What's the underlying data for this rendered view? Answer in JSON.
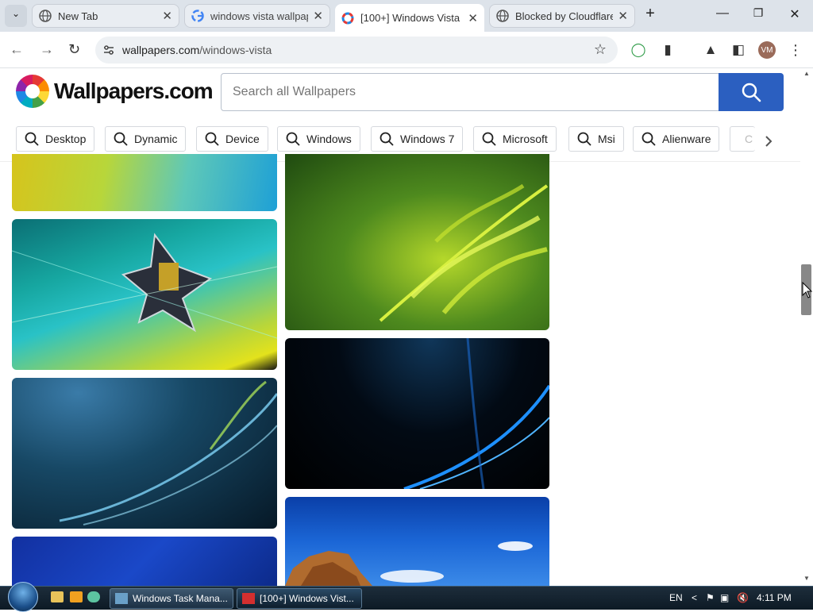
{
  "browser": {
    "tabs": [
      {
        "title": "New Tab",
        "favicon": "globe-icon",
        "active": false
      },
      {
        "title": "windows vista wallpaper",
        "favicon": "google-icon",
        "active": false
      },
      {
        "title": "[100+] Windows Vista",
        "favicon": "wallpapers-icon",
        "active": true
      },
      {
        "title": "Blocked by Cloudflare",
        "favicon": "globe-icon",
        "active": false
      }
    ],
    "url_host": "wallpapers.com",
    "url_path": "/windows-vista",
    "profile_initials": "VM"
  },
  "site": {
    "logo_text": "Wallpapers.com",
    "search_placeholder": "Search all Wallpapers",
    "chips": [
      "Desktop",
      "Dynamic",
      "Device",
      "Windows",
      "Windows 7",
      "Microsoft",
      "Msi",
      "Alienware",
      "C"
    ],
    "accent": "#2b5fc0",
    "wallpapers": [
      {
        "name": "wallpaper-yellow-teal"
      },
      {
        "name": "wallpaper-shattered-motherboard"
      },
      {
        "name": "wallpaper-blue-aurora"
      },
      {
        "name": "wallpaper-blue-partial"
      },
      {
        "name": "wallpaper-green-fern"
      },
      {
        "name": "wallpaper-black-blue-streak"
      },
      {
        "name": "wallpaper-sky-rocks"
      }
    ]
  },
  "taskbar": {
    "items": [
      {
        "label": "Windows Task Mana..."
      },
      {
        "label": "[100+] Windows Vist..."
      }
    ],
    "language": "EN",
    "time": "4:11 PM"
  }
}
